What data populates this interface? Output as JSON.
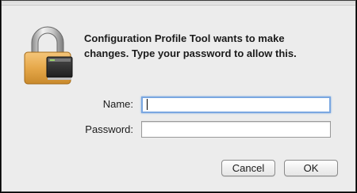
{
  "dialog": {
    "message_lines": [
      "Configuration Profile Tool wants to make",
      "changes. Type your password to allow this."
    ]
  },
  "form": {
    "name_label": "Name:",
    "name_value": "",
    "password_label": "Password:",
    "password_value": ""
  },
  "buttons": {
    "cancel_label": "Cancel",
    "ok_label": "OK"
  },
  "icons": {
    "lock": "lock-icon"
  },
  "colors": {
    "focus_ring": "#7aa7e1",
    "window_bg": "#ececec",
    "lock_body": "#e6a84a"
  }
}
